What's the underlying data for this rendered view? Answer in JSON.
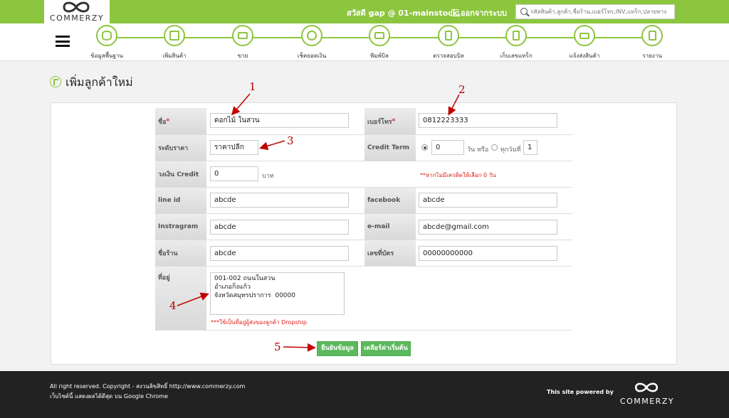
{
  "brand": {
    "logo_text": "COMMERZY"
  },
  "header": {
    "greeting": "สวัสดี gap @ 01-mainstock,",
    "logout": "ออกจากระบบ",
    "search_placeholder": "รหัสสินค้า,ลูกค้า,ชื่อร้าน,เบอร์โทร,INV,แทร็ก,ปลายทาง"
  },
  "nav": {
    "items": [
      {
        "label": "ข้อมูลพื้นฐาน",
        "icon": "database-icon"
      },
      {
        "label": "เพิ่มสินค้า",
        "icon": "box-icon"
      },
      {
        "label": "ขาย",
        "icon": "cash-register-icon"
      },
      {
        "label": "เช็คยอดเงิน",
        "icon": "check-money-icon"
      },
      {
        "label": "พิมพ์บิล",
        "icon": "printer-icon"
      },
      {
        "label": "ตรวจสอบบิล",
        "icon": "scanner-icon"
      },
      {
        "label": "เก็บเลขแทร็ก",
        "icon": "barcode-scanner-icon"
      },
      {
        "label": "แจ้งส่งสินค้า",
        "icon": "truck-icon"
      },
      {
        "label": "รายงาน",
        "icon": "report-icon"
      }
    ]
  },
  "page": {
    "title": "เพิ่มลูกค้าใหม่"
  },
  "form": {
    "name_label": "ชื่อ",
    "name_value": "ดอกไม้ ในสวน",
    "phone_label": "เบอร์โทร",
    "phone_value": "0812223333",
    "price_label": "ระดับราคา",
    "price_value": "ราคาปลีก",
    "credit_term_label": "Credit Term",
    "credit_days_value": "0",
    "credit_days_unit": "วัน หรือ",
    "every_day_label": "ทุกวันที่",
    "every_day_value": "1",
    "credit_note": "**หากไม่มีเครดิตให้เลือก 0 วัน",
    "credit_limit_label": "วงเงิน Credit",
    "credit_limit_value": "0",
    "credit_limit_unit": "บาท",
    "line_label": "line id",
    "line_value": "abcde",
    "facebook_label": "facebook",
    "facebook_value": "abcde",
    "instagram_label": "Instragram",
    "instagram_value": "abcde",
    "email_label": "e-mail",
    "email_value": "abcde@gmail.com",
    "shop_label": "ชื่อร้าน",
    "shop_value": "abcde",
    "card_label": "เลขที่บัตร",
    "card_value": "00000000000",
    "address_label": "ที่อยู่",
    "address_value": "001-002 ถนนในสวน\nอำเภอกิ่งแก้ว\nจังหวัดสมุทรปราการ  00000",
    "address_note": "***ใช้เป็นที่อยู่ผู้ส่งของลูกค้า Dropship",
    "required_mark": "*"
  },
  "buttons": {
    "save": "ยืนยันข้อมูล",
    "clear": "เคลียร์ค่าเริ่มต้น"
  },
  "annotations": [
    "1",
    "2",
    "3",
    "4",
    "5"
  ],
  "footer": {
    "line1": "All right reserved. Copyright - สงวนลิขสิทธิ์ http://www.commerzy.com",
    "line2": "เว็บไซต์นี้ แสดงผลได้ดีสุด บน Google Chrome",
    "powered": "This site powered by",
    "logo_text": "COMMERZY"
  },
  "colors": {
    "brand_green": "#8cc63f",
    "button_green": "#5cb85c",
    "required_red": "#e02020",
    "annotation_red": "#b00000",
    "footer_bg": "#222222"
  }
}
